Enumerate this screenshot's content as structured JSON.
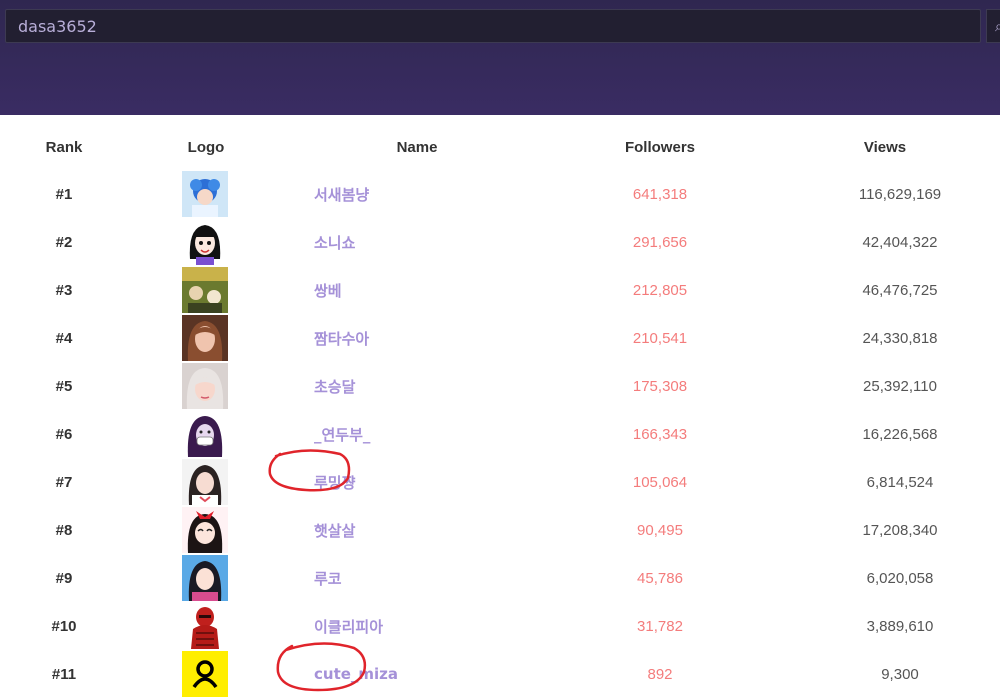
{
  "search": {
    "value": "dasa3652"
  },
  "columns": {
    "rank": "Rank",
    "logo": "Logo",
    "name": "Name",
    "followers": "Followers",
    "views": "Views"
  },
  "rows": [
    {
      "rank": "#1",
      "name": "서새봄냥",
      "followers": "641,318",
      "views": "116,629,169"
    },
    {
      "rank": "#2",
      "name": "소니쇼",
      "followers": "291,656",
      "views": "42,404,322"
    },
    {
      "rank": "#3",
      "name": "쌍베",
      "followers": "212,805",
      "views": "46,476,725"
    },
    {
      "rank": "#4",
      "name": "짬타수아",
      "followers": "210,541",
      "views": "24,330,818"
    },
    {
      "rank": "#5",
      "name": "초승달",
      "followers": "175,308",
      "views": "25,392,110"
    },
    {
      "rank": "#6",
      "name": "_연두부_",
      "followers": "166,343",
      "views": "16,226,568"
    },
    {
      "rank": "#7",
      "name": "루밍쨩",
      "followers": "105,064",
      "views": "6,814,524"
    },
    {
      "rank": "#8",
      "name": "햇살살",
      "followers": "90,495",
      "views": "17,208,340"
    },
    {
      "rank": "#9",
      "name": "루코",
      "followers": "45,786",
      "views": "6,020,058"
    },
    {
      "rank": "#10",
      "name": "이클리피아",
      "followers": "31,782",
      "views": "3,889,610"
    },
    {
      "rank": "#11",
      "name": "cute_miza",
      "followers": "892",
      "views": "9,300"
    }
  ],
  "colors": {
    "header_bg": "#3a2c63",
    "name_link": "#a591d8",
    "followers": "#f47c7c",
    "annotation": "#e0242b"
  }
}
